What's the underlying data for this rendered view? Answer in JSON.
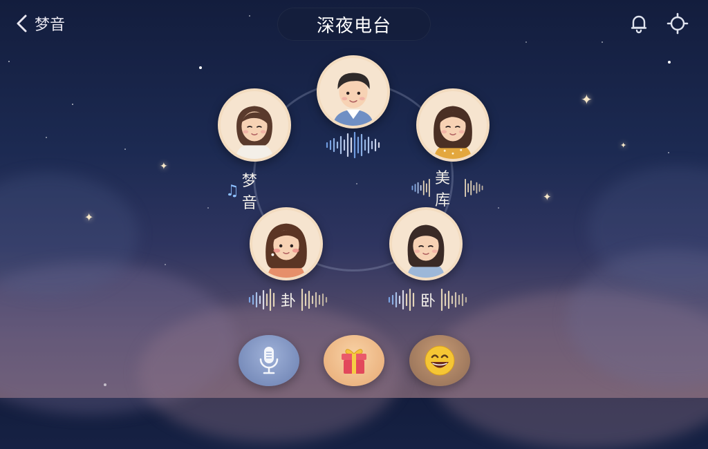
{
  "header": {
    "back_label": "梦音",
    "title": "深夜电台"
  },
  "seats": [
    {
      "name": "",
      "speaking": true
    },
    {
      "name": "梦音",
      "speaking": false
    },
    {
      "name": "美库",
      "speaking": true
    },
    {
      "name": "卦",
      "speaking": true
    },
    {
      "name": "卧",
      "speaking": true
    }
  ],
  "icons": {
    "back": "chevron-left-icon",
    "bell": "bell-icon",
    "settings": "settings-icon",
    "music_note": "music-note-icon",
    "mic": "microphone-icon",
    "gift": "gift-icon",
    "emoji": "smile-emoji-icon"
  },
  "colors": {
    "accent_blue": "#8ec1ff",
    "avatar_border": "#f3dcc0"
  }
}
